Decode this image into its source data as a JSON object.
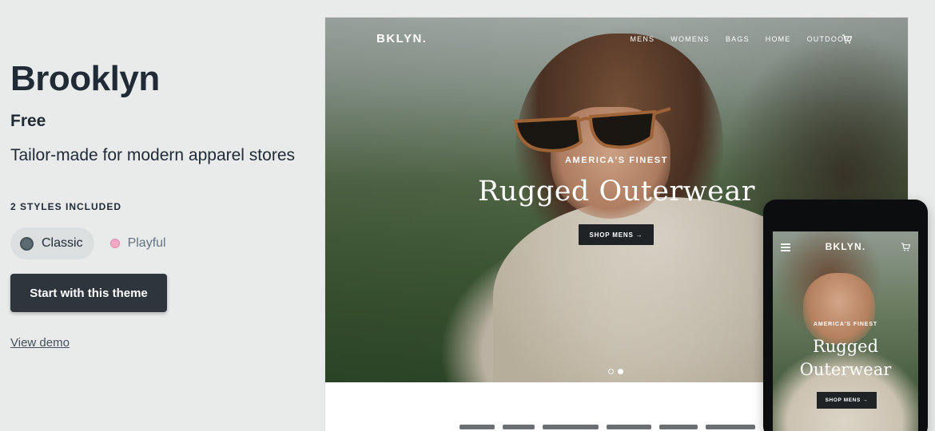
{
  "theme": {
    "name": "Brooklyn",
    "price": "Free",
    "tagline": "Tailor-made for modern apparel stores"
  },
  "styles": {
    "heading": "2 STYLES INCLUDED",
    "options": [
      {
        "label": "Classic",
        "color": "#5c6a72",
        "selected": true
      },
      {
        "label": "Playful",
        "color": "#f3a8c4",
        "selected": false
      }
    ]
  },
  "actions": {
    "start_label": "Start with this theme",
    "demo_label": "View demo"
  },
  "desktop_preview": {
    "brand": "BKLYN.",
    "nav": [
      "MENS",
      "WOMENS",
      "BAGS",
      "HOME",
      "OUTDOOR"
    ],
    "cart_icon": "cart-icon",
    "kicker": "AMERICA'S FINEST",
    "title": "Rugged Outerwear",
    "cta": "SHOP MENS →",
    "slides": {
      "count": 2,
      "active": 2
    }
  },
  "mobile_preview": {
    "menu_icon": "hamburger-icon",
    "brand": "BKLYN.",
    "cart_icon": "cart-icon",
    "kicker": "AMERICA'S FINEST",
    "title_line1": "Rugged",
    "title_line2": "Outerwear",
    "cta": "SHOP MENS →"
  },
  "colors": {
    "page_background": "#e9ebeb",
    "primary_button": "#2f353d",
    "text": "#212b36",
    "cta_dark": "#1f2326"
  }
}
